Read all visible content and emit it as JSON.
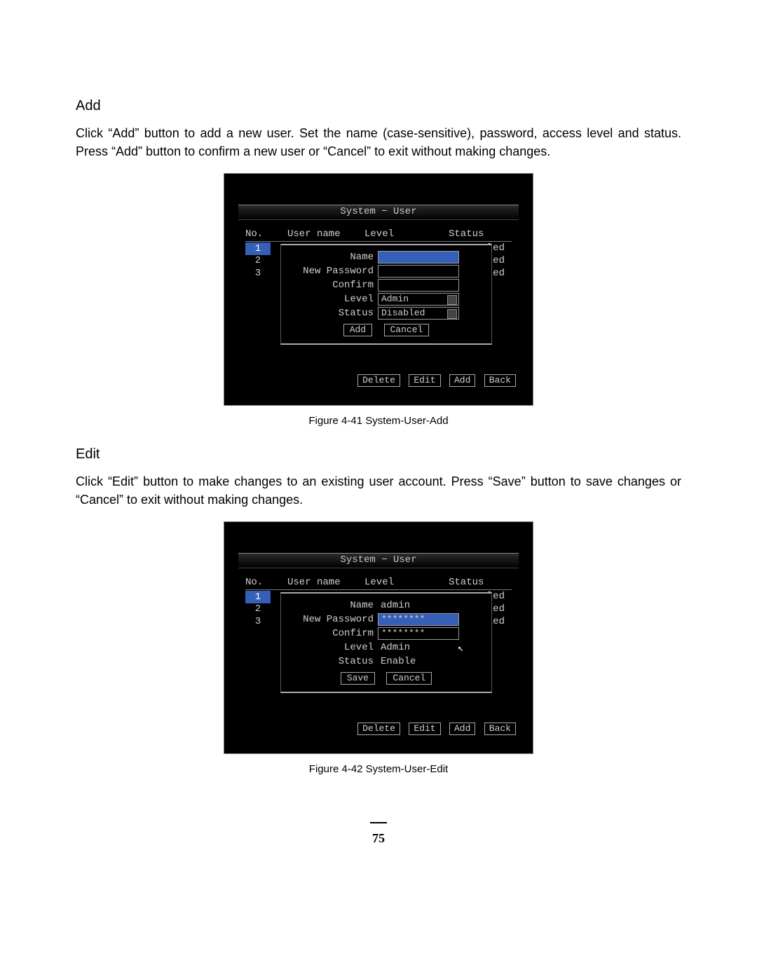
{
  "section_add": {
    "heading": "Add",
    "body": "Click “Add” button to add a new user. Set the name (case-sensitive), password, access level and status. Press “Add” button to confirm a new user or “Cancel” to exit without making changes.",
    "caption": "Figure 4-41 System-User-Add"
  },
  "section_edit": {
    "heading": "Edit",
    "body": "Click “Edit” button to make changes to an existing user account. Press “Save” button to save changes or “Cancel” to exit without making changes.",
    "caption": "Figure 4-42 System-User-Edit"
  },
  "dvr_common": {
    "title": "System − User",
    "col_no": "No.",
    "col_user": "User name",
    "col_level": "Level",
    "col_status": "Status",
    "status_tail": "led",
    "row_nos": [
      "1",
      "2",
      "3"
    ],
    "footer_delete": "Delete",
    "footer_edit": "Edit",
    "footer_add": "Add",
    "footer_back": "Back"
  },
  "popup_add": {
    "name_label": "Name",
    "name_value": "",
    "newpw_label": "New Password",
    "newpw_value": "",
    "confirm_label": "Confirm",
    "confirm_value": "",
    "level_label": "Level",
    "level_value": "Admin",
    "status_label": "Status",
    "status_value": "Disabled",
    "btn_primary": "Add",
    "btn_cancel": "Cancel"
  },
  "popup_edit": {
    "name_label": "Name",
    "name_value": "admin",
    "newpw_label": "New Password",
    "newpw_value": "********",
    "confirm_label": "Confirm",
    "confirm_value": "********",
    "level_label": "Level",
    "level_value": "Admin",
    "status_label": "Status",
    "status_value": "Enable",
    "btn_primary": "Save",
    "btn_cancel": "Cancel"
  },
  "page_number": "75"
}
